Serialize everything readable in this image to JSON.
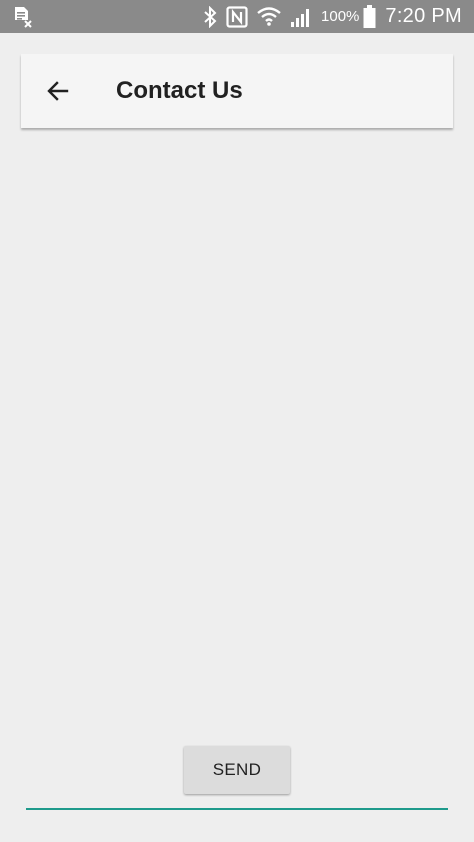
{
  "status_bar": {
    "battery_percent": "100%",
    "time": "7:20 PM",
    "icons": [
      "notification-sim-icon",
      "bluetooth-icon",
      "nfc-icon",
      "wifi-icon",
      "signal-icon",
      "battery-icon"
    ]
  },
  "app_bar": {
    "back_icon": "arrow-back-icon",
    "title": "Contact Us"
  },
  "actions": {
    "send_label": "SEND"
  },
  "colors": {
    "status_bar_bg": "#8a8a8a",
    "app_bar_bg": "#f5f5f5",
    "page_bg": "#eeeeee",
    "accent_underline": "#1e9a8b",
    "button_bg": "#dcdcdc"
  }
}
